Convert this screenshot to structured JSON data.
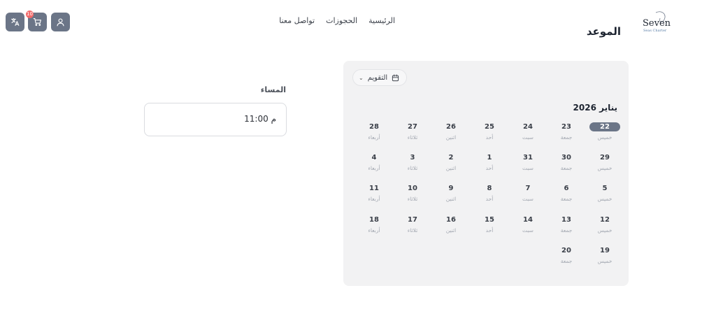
{
  "header": {
    "cart_count": "10",
    "nav": [
      "الرئيسية",
      "الحجوزات",
      "تواصل معنا"
    ],
    "logo_text": [
      "Seven",
      "Seas Charter"
    ],
    "page_title": "الموعد"
  },
  "calendar": {
    "toggle_label": "التقويم",
    "month_label": "يناير 2026",
    "selected_day": "22",
    "days": [
      {
        "num": "22",
        "wd": "خميس"
      },
      {
        "num": "23",
        "wd": "جمعة"
      },
      {
        "num": "24",
        "wd": "سبت"
      },
      {
        "num": "25",
        "wd": "أحد"
      },
      {
        "num": "26",
        "wd": "اثنين"
      },
      {
        "num": "27",
        "wd": "ثلاثاء"
      },
      {
        "num": "28",
        "wd": "أربعاء"
      },
      {
        "num": "29",
        "wd": "خميس"
      },
      {
        "num": "30",
        "wd": "جمعة"
      },
      {
        "num": "31",
        "wd": "سبت"
      },
      {
        "num": "1",
        "wd": "أحد"
      },
      {
        "num": "2",
        "wd": "اثنين"
      },
      {
        "num": "3",
        "wd": "ثلاثاء"
      },
      {
        "num": "4",
        "wd": "أربعاء"
      },
      {
        "num": "5",
        "wd": "خميس"
      },
      {
        "num": "6",
        "wd": "جمعة"
      },
      {
        "num": "7",
        "wd": "سبت"
      },
      {
        "num": "8",
        "wd": "أحد"
      },
      {
        "num": "9",
        "wd": "اثنين"
      },
      {
        "num": "10",
        "wd": "ثلاثاء"
      },
      {
        "num": "11",
        "wd": "أربعاء"
      },
      {
        "num": "12",
        "wd": "خميس"
      },
      {
        "num": "13",
        "wd": "جمعة"
      },
      {
        "num": "14",
        "wd": "سبت"
      },
      {
        "num": "15",
        "wd": "أحد"
      },
      {
        "num": "16",
        "wd": "اثنين"
      },
      {
        "num": "17",
        "wd": "ثلاثاء"
      },
      {
        "num": "18",
        "wd": "أربعاء"
      },
      {
        "num": "19",
        "wd": "خميس"
      },
      {
        "num": "20",
        "wd": "جمعة"
      }
    ]
  },
  "times": {
    "section_label": "المساء",
    "slots": [
      "11:00 م"
    ]
  },
  "colors": {
    "accent": "#6b7587",
    "badge": "#f26b6b",
    "panel_bg": "#f2f2f3"
  }
}
